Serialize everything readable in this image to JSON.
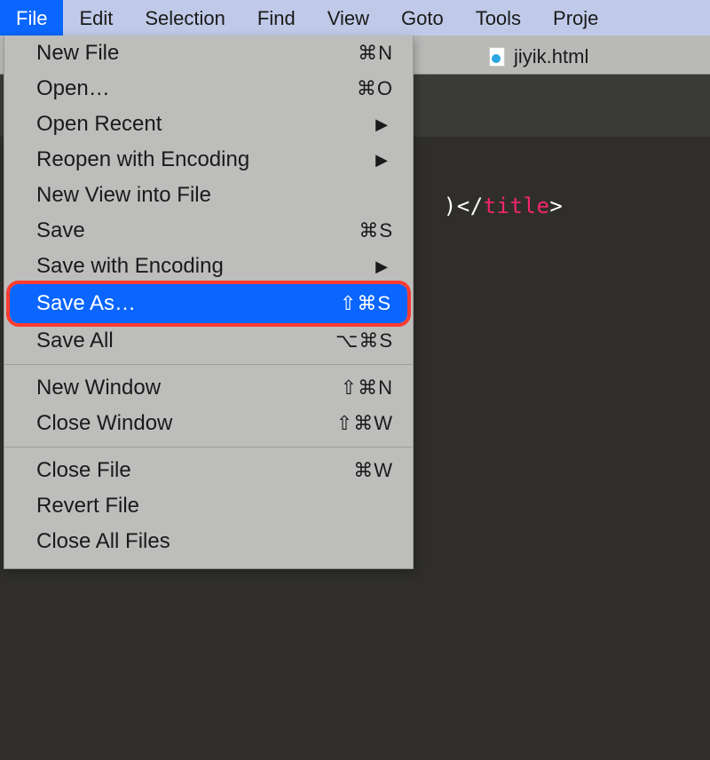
{
  "menubar": {
    "items": [
      {
        "label": "File",
        "active": true
      },
      {
        "label": "Edit",
        "active": false
      },
      {
        "label": "Selection",
        "active": false
      },
      {
        "label": "Find",
        "active": false
      },
      {
        "label": "View",
        "active": false
      },
      {
        "label": "Goto",
        "active": false
      },
      {
        "label": "Tools",
        "active": false
      },
      {
        "label": "Proje",
        "active": false
      }
    ]
  },
  "tab": {
    "filename": "jiyik.html"
  },
  "code": {
    "frag_plain_1": ")</",
    "frag_tag": "title",
    "frag_plain_2": ">"
  },
  "file_menu": {
    "items": [
      {
        "label": "New File",
        "shortcut": "⌘N",
        "submenu": false,
        "highlighted": false
      },
      {
        "label": "Open…",
        "shortcut": "⌘O",
        "submenu": false,
        "highlighted": false
      },
      {
        "label": "Open Recent",
        "shortcut": "",
        "submenu": true,
        "highlighted": false
      },
      {
        "label": "Reopen with Encoding",
        "shortcut": "",
        "submenu": true,
        "highlighted": false
      },
      {
        "label": "New View into File",
        "shortcut": "",
        "submenu": false,
        "highlighted": false
      },
      {
        "label": "Save",
        "shortcut": "⌘S",
        "submenu": false,
        "highlighted": false
      },
      {
        "label": "Save with Encoding",
        "shortcut": "",
        "submenu": true,
        "highlighted": false
      },
      {
        "label": "Save As…",
        "shortcut": "⇧⌘S",
        "submenu": false,
        "highlighted": true
      },
      {
        "label": "Save All",
        "shortcut": "⌥⌘S",
        "submenu": false,
        "highlighted": false
      },
      {
        "label": "New Window",
        "shortcut": "⇧⌘N",
        "submenu": false,
        "highlighted": false
      },
      {
        "label": "Close Window",
        "shortcut": "⇧⌘W",
        "submenu": false,
        "highlighted": false
      },
      {
        "label": "Close File",
        "shortcut": "⌘W",
        "submenu": false,
        "highlighted": false
      },
      {
        "label": "Revert File",
        "shortcut": "",
        "submenu": false,
        "highlighted": false
      },
      {
        "label": "Close All Files",
        "shortcut": "",
        "submenu": false,
        "highlighted": false
      }
    ],
    "separators_after_index": [
      8,
      10
    ]
  },
  "glyphs": {
    "submenu_arrow": "▶"
  }
}
